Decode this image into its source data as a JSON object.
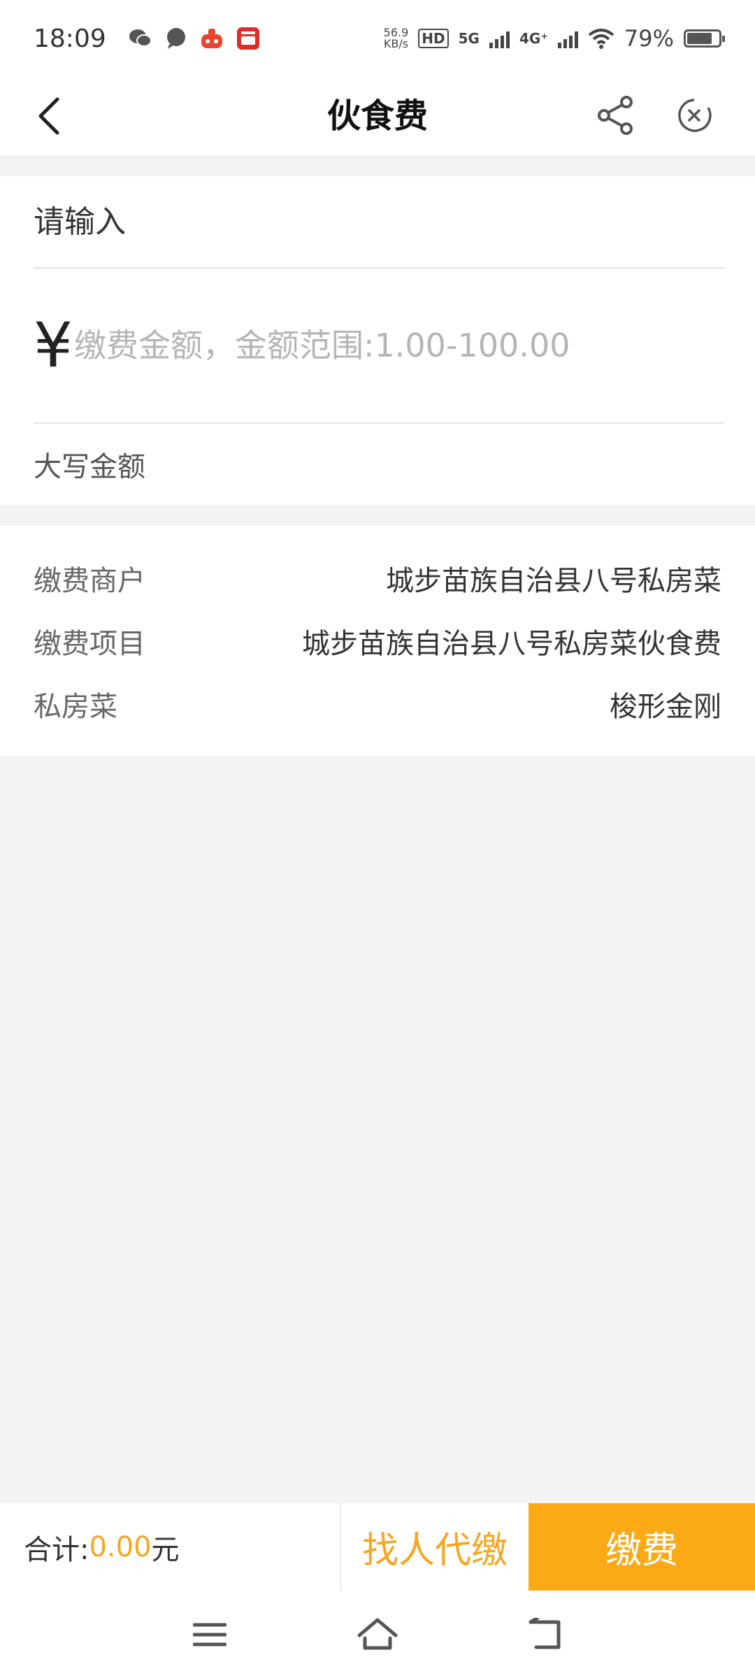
{
  "status_bar": {
    "time": "18:09",
    "net_speed_value": "56.9",
    "net_speed_unit": "KB/s",
    "hd_badge": "HD",
    "network_5g": "5G",
    "network_4g": "4G⁺",
    "battery_percent": "79%",
    "battery_level": 0.79
  },
  "navbar": {
    "title": "伙食费",
    "icons": [
      "back-arrow-icon",
      "share-icon",
      "close-circle-icon"
    ]
  },
  "form": {
    "input_placeholder": "请输入",
    "currency_symbol": "¥",
    "amount_placeholder": "缴费金额，金额范围:1.00-100.00",
    "capital_amount_label": "大写金额"
  },
  "info": [
    {
      "label": "缴费商户",
      "value": "城步苗族自治县八号私房菜"
    },
    {
      "label": "缴费项目",
      "value": "城步苗族自治县八号私房菜伙食费"
    },
    {
      "label": "私房菜",
      "value": "梭形金刚"
    }
  ],
  "bottom_bar": {
    "total_label": "合计:",
    "total_value": "0.00",
    "total_unit": "元",
    "proxy_button": "找人代缴",
    "pay_button": "缴费"
  },
  "colors": {
    "accent": "#fba914",
    "accent_text": "#f5a623"
  }
}
